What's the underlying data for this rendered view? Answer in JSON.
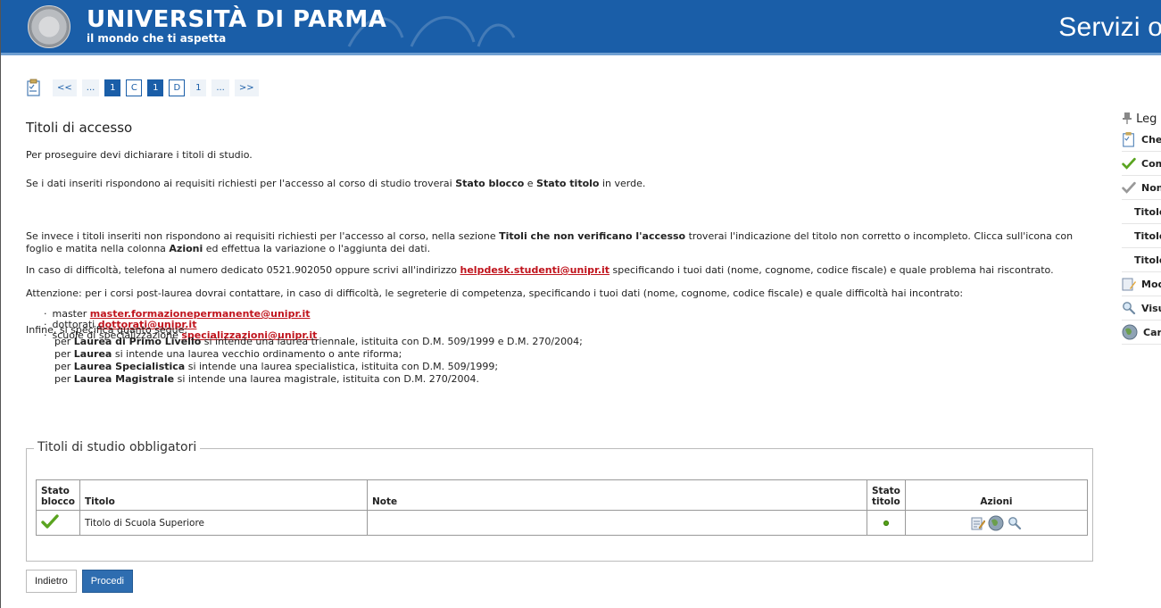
{
  "header": {
    "university": "UNIVERSITÀ DI PARMA",
    "tagline": "il mondo che ti aspetta",
    "services": "Servizi on"
  },
  "pager": {
    "items": [
      "<<",
      "...",
      "1",
      "C",
      "1",
      "D",
      "1",
      "...",
      ">>"
    ]
  },
  "page": {
    "title": "Titoli di accesso",
    "intro": "Per proseguire devi dichiarare i titoli di studio.",
    "p2_a": "Se i dati inseriti rispondono ai requisiti richiesti per l'accesso al corso di studio troverai ",
    "p2_b1": "Stato blocco",
    "p2_b2": " e ",
    "p2_b3": "Stato titolo",
    "p2_c": " in verde.",
    "p3_a": "Se invece i titoli inseriti non rispondono ai requisiti richiesti per l'accesso al corso, nella sezione ",
    "p3_b": "Titoli che non verificano l'accesso",
    "p3_c": " troverai l'indicazione del titolo non corretto o incompleto. Clicca sull'icona con foglio e matita nella colonna ",
    "p3_d": "Azioni",
    "p3_e": " ed effettua la variazione o l'aggiunta dei dati.",
    "p4_a": "In caso di difficoltà, telefona al numero dedicato 0521.902050 oppure scrivi all'indirizzo ",
    "p4_mail": "helpdesk.studenti@unipr.it",
    "p4_b": " specificando i tuoi dati (nome, cognome, codice fiscale) e quale problema hai riscontrato.",
    "p5": "Attenzione: per i corsi post-laurea dovrai contattare, in caso di difficoltà, le segreterie di competenza, specificando i tuoi dati (nome, cognome, codice fiscale) e quale difficoltà hai incontrato:",
    "mails": [
      {
        "label": "master ",
        "mail": "master.formazionepermanente@unipr.it"
      },
      {
        "label": "dottorati ",
        "mail": "dottorati@unipr.it"
      },
      {
        "label": "scuole di specializzazione ",
        "mail": "specializzazioni@unipr.it"
      }
    ],
    "infine": "Infine, si specifica quanto segue:",
    "defs": [
      {
        "pre": "per ",
        "bold": "Laurea di Primo Livello",
        "post": " si intende una laurea triennale, istituita con D.M. 509/1999 e D.M. 270/2004;"
      },
      {
        "pre": "per ",
        "bold": "Laurea",
        "post": " si intende una laurea vecchio ordinamento o ante riforma;"
      },
      {
        "pre": "per ",
        "bold": "Laurea Specialistica",
        "post": " si intende una laurea specialistica, istituita con D.M. 509/1999;"
      },
      {
        "pre": "per ",
        "bold": "Laurea Magistrale",
        "post": " si intende una laurea magistrale, istituita con D.M. 270/2004."
      }
    ]
  },
  "table": {
    "legend": "Titoli di studio obbligatori",
    "headers": {
      "stato_blocco_1": "Stato",
      "stato_blocco_2": "blocco",
      "titolo": "Titolo",
      "note": "Note",
      "stato_titolo_1": "Stato",
      "stato_titolo_2": "titolo",
      "azioni": "Azioni"
    },
    "rows": [
      {
        "titolo": "Titolo di Scuola Superiore",
        "note": ""
      }
    ]
  },
  "buttons": {
    "back": "Indietro",
    "next": "Procedi"
  },
  "legend": {
    "title": "Leg",
    "items": [
      "Che",
      "Com",
      "Non",
      "Titolo",
      "Titolo",
      "Titolo",
      "Mod",
      "Visu",
      "Car"
    ]
  },
  "colors": {
    "brand_blue": "#1a5ea8",
    "link_red": "#c0141d",
    "ok_green": "#55a318"
  }
}
